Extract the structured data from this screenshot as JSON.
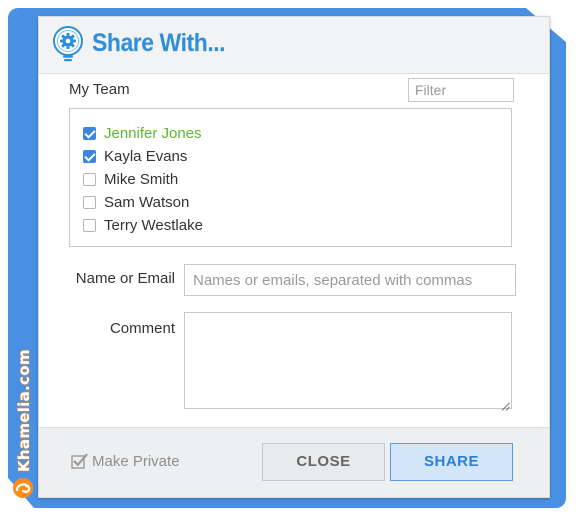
{
  "dialog": {
    "title": "Share With...",
    "icon": "lightbulb-gear-icon"
  },
  "team": {
    "label": "My Team",
    "filter_placeholder": "Filter",
    "members": [
      {
        "name": "Jennifer Jones",
        "checked": true,
        "highlighted": true
      },
      {
        "name": "Kayla Evans",
        "checked": true,
        "highlighted": false
      },
      {
        "name": "Mike Smith",
        "checked": false,
        "highlighted": false
      },
      {
        "name": "Sam Watson",
        "checked": false,
        "highlighted": false
      },
      {
        "name": "Terry Westlake",
        "checked": false,
        "highlighted": false
      }
    ]
  },
  "form": {
    "name_email_label": "Name or Email",
    "name_email_placeholder": "Names or emails, separated with commas",
    "comment_label": "Comment",
    "comment_value": ""
  },
  "footer": {
    "private_label": "Make Private",
    "private_checked": true,
    "close_label": "CLOSE",
    "share_label": "SHARE"
  },
  "watermark": {
    "text": "Khamelia.com"
  },
  "colors": {
    "accent": "#2f8fd8",
    "frame": "#4a90e2",
    "highlight_name": "#5cb82e",
    "checkbox_checked": "#3a86e0",
    "share_button_bg": "#d3e5f9",
    "watermark_orange": "#ff8c1a"
  }
}
